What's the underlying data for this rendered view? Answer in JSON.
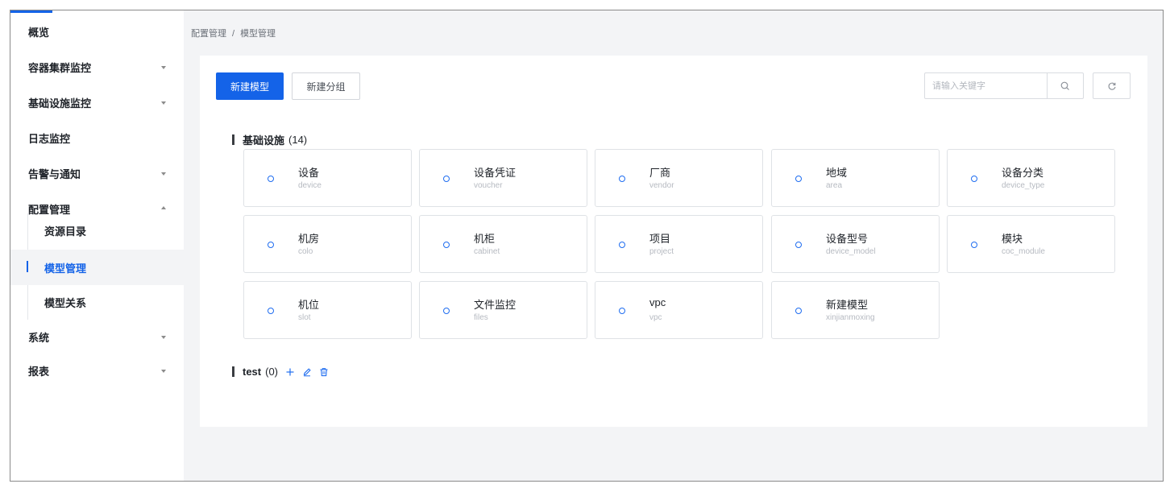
{
  "sidebar": {
    "items": [
      {
        "label": "概览",
        "caret": null
      },
      {
        "label": "容器集群监控",
        "caret": "down"
      },
      {
        "label": "基础设施监控",
        "caret": "down"
      },
      {
        "label": "日志监控",
        "caret": null
      },
      {
        "label": "告警与通知",
        "caret": "down"
      },
      {
        "label": "配置管理",
        "caret": "up"
      }
    ],
    "sub_items": [
      {
        "label": "资源目录",
        "active": false
      },
      {
        "label": "模型管理",
        "active": true
      },
      {
        "label": "模型关系",
        "active": false
      }
    ],
    "bottom_items": [
      {
        "label": "系统",
        "caret": "down"
      },
      {
        "label": "报表",
        "caret": "down"
      }
    ]
  },
  "breadcrumb": {
    "parent": "配置管理",
    "separator": "/",
    "current": "模型管理"
  },
  "toolbar": {
    "new_model_label": "新建模型",
    "new_group_label": "新建分组",
    "search_placeholder": "请输入关键字",
    "search_value": ""
  },
  "groups": [
    {
      "name": "基础设施",
      "count": "(14)",
      "models": [
        {
          "name": "设备",
          "code": "device"
        },
        {
          "name": "设备凭证",
          "code": "voucher"
        },
        {
          "name": "厂商",
          "code": "vendor"
        },
        {
          "name": "地域",
          "code": "area"
        },
        {
          "name": "设备分类",
          "code": "device_type"
        },
        {
          "name": "机房",
          "code": "colo"
        },
        {
          "name": "机柜",
          "code": "cabinet"
        },
        {
          "name": "项目",
          "code": "project"
        },
        {
          "name": "设备型号",
          "code": "device_model"
        },
        {
          "name": "模块",
          "code": "coc_module"
        },
        {
          "name": "机位",
          "code": "slot"
        },
        {
          "name": "文件监控",
          "code": "files"
        },
        {
          "name": "vpc",
          "code": "vpc"
        },
        {
          "name": "新建模型",
          "code": "xinjianmoxing"
        }
      ]
    },
    {
      "name": "test",
      "count": "(0)",
      "models": []
    }
  ],
  "icons": {
    "search": "search-icon",
    "refresh": "refresh-icon",
    "add": "plus-icon",
    "edit": "edit-icon",
    "delete": "trash-icon",
    "model": "circle-icon"
  },
  "colors": {
    "accent": "#1463e8",
    "page_bg": "#f3f4f6",
    "icon_blue": "#1f6df0"
  }
}
